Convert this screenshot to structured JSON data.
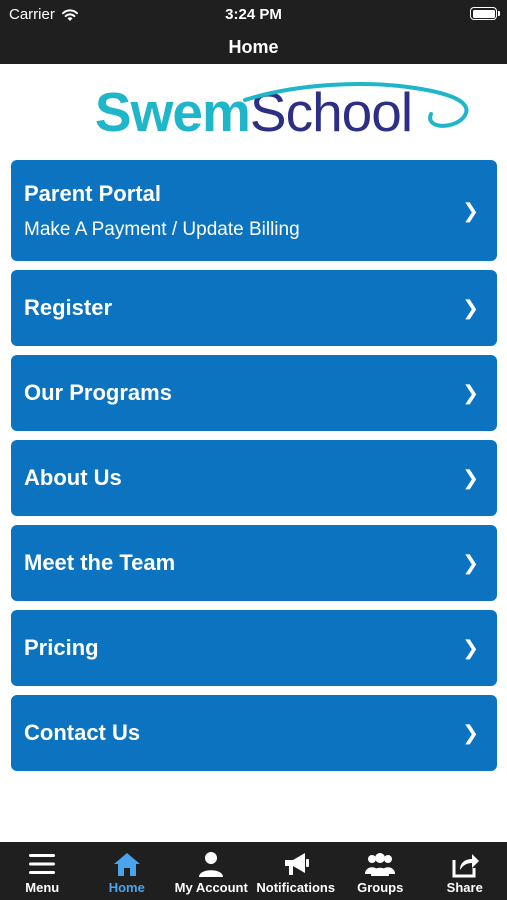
{
  "status_bar": {
    "carrier": "Carrier",
    "time": "3:24 PM"
  },
  "header": {
    "title": "Home"
  },
  "logo": {
    "part1": "Swem",
    "part2": "School",
    "color_teal": "#1fb6c9",
    "color_navy": "#2c2f83"
  },
  "menu": {
    "items": [
      {
        "title": "Parent Portal",
        "subtitle": "Make A Payment / Update Billing",
        "chevron": "❯"
      },
      {
        "title": "Register",
        "chevron": "❯"
      },
      {
        "title": "Our Programs",
        "chevron": "❯"
      },
      {
        "title": "About Us",
        "chevron": "❯"
      },
      {
        "title": "Meet the Team",
        "chevron": "❯"
      },
      {
        "title": "Pricing",
        "chevron": "❯"
      },
      {
        "title": "Contact Us",
        "chevron": "❯"
      }
    ],
    "button_color": "#0b73c0"
  },
  "tabbar": {
    "tabs": [
      {
        "label": "Menu",
        "icon": "hamburger-icon"
      },
      {
        "label": "Home",
        "icon": "home-icon",
        "active": true
      },
      {
        "label": "My Account",
        "icon": "person-icon"
      },
      {
        "label": "Notifications",
        "icon": "megaphone-icon"
      },
      {
        "label": "Groups",
        "icon": "group-icon"
      },
      {
        "label": "Share",
        "icon": "share-icon"
      }
    ],
    "active_color": "#4aa3ec"
  }
}
